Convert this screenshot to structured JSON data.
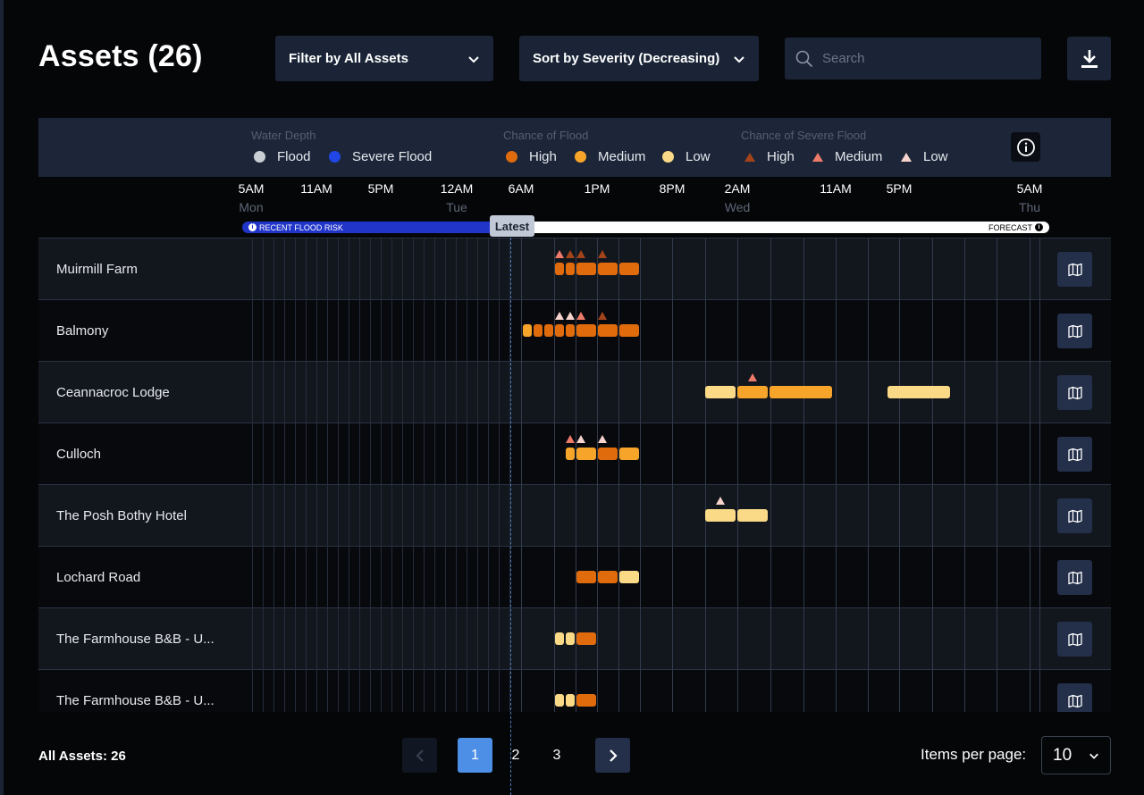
{
  "header": {
    "title": "Assets (26)",
    "filter_label": "Filter by All Assets",
    "sort_label": "Sort by Severity (Decreasing)",
    "search_placeholder": "Search"
  },
  "legend": {
    "water_depth": {
      "heading": "Water Depth",
      "items": [
        {
          "label": "Flood",
          "color": "#c9cdd4"
        },
        {
          "label": "Severe Flood",
          "color": "#2146e6"
        }
      ]
    },
    "chance_flood": {
      "heading": "Chance of Flood",
      "items": [
        {
          "label": "High",
          "color": "#e06b0c"
        },
        {
          "label": "Medium",
          "color": "#f7a52a"
        },
        {
          "label": "Low",
          "color": "#fad987"
        }
      ]
    },
    "chance_severe": {
      "heading": "Chance of Severe Flood",
      "items": [
        {
          "label": "High",
          "color": "#a3431a"
        },
        {
          "label": "Medium",
          "color": "#ee7a6a"
        },
        {
          "label": "Low",
          "color": "#f6d3cc"
        }
      ]
    }
  },
  "timeline": {
    "times": [
      "5AM",
      "11AM",
      "5PM",
      "12AM",
      "6AM",
      "1PM",
      "8PM",
      "2AM",
      "11AM",
      "5PM",
      "5AM"
    ],
    "days": [
      "Mon",
      "Tue",
      "Wed",
      "Thu"
    ],
    "recent_label": "RECENT FLOOD RISK",
    "forecast_label": "FORECAST",
    "latest_label": "Latest"
  },
  "assets": [
    {
      "name": "Muirmill Farm",
      "pills": [
        [
          "high",
          0,
          0
        ],
        [
          "high",
          1,
          1
        ],
        [
          "high",
          2,
          3
        ],
        [
          "high",
          4,
          5
        ],
        [
          "high",
          6,
          7
        ]
      ],
      "marks": [
        [
          "med",
          0
        ],
        [
          "high",
          1
        ],
        [
          "high",
          2
        ],
        [
          "high",
          4
        ]
      ]
    },
    {
      "name": "Balmony",
      "pills": [
        [
          "med",
          -3,
          -3
        ],
        [
          "high",
          -2,
          -2
        ],
        [
          "high",
          -1,
          -1
        ],
        [
          "high",
          0,
          0
        ],
        [
          "high",
          1,
          1
        ],
        [
          "high",
          2,
          3
        ],
        [
          "high",
          4,
          5
        ],
        [
          "high",
          6,
          7
        ]
      ],
      "marks": [
        [
          "low",
          0
        ],
        [
          "low",
          1
        ],
        [
          "med",
          2
        ],
        [
          "high",
          4
        ]
      ]
    },
    {
      "name": "Ceannacroc Lodge",
      "pills": [
        [
          "low",
          14,
          16
        ],
        [
          "med",
          17,
          19
        ],
        [
          "med",
          20,
          25
        ],
        [
          "low",
          31,
          36
        ]
      ],
      "marks": [
        [
          "med",
          18
        ]
      ]
    },
    {
      "name": "Culloch",
      "pills": [
        [
          "med",
          1,
          1
        ],
        [
          "med",
          2,
          3
        ],
        [
          "high",
          4,
          5
        ],
        [
          "med",
          6,
          7
        ]
      ],
      "marks": [
        [
          "med",
          1
        ],
        [
          "low",
          2
        ],
        [
          "low",
          4
        ]
      ]
    },
    {
      "name": "The Posh Bothy Hotel",
      "pills": [
        [
          "low",
          14,
          16
        ],
        [
          "low",
          17,
          19
        ]
      ],
      "marks": [
        [
          "low",
          15
        ]
      ]
    },
    {
      "name": "Lochard Road",
      "pills": [
        [
          "high",
          2,
          3
        ],
        [
          "high",
          4,
          5
        ],
        [
          "low",
          6,
          7
        ]
      ],
      "marks": []
    },
    {
      "name": "The Farmhouse B&B - U...",
      "pills": [
        [
          "low",
          0,
          0
        ],
        [
          "low",
          1,
          1
        ],
        [
          "high",
          2,
          3
        ]
      ],
      "marks": []
    },
    {
      "name": "The Farmhouse B&B - U...",
      "pills": [
        [
          "low",
          0,
          0
        ],
        [
          "low",
          1,
          1
        ],
        [
          "high",
          2,
          3
        ]
      ],
      "marks": []
    }
  ],
  "footer": {
    "total": "All Assets: 26",
    "pages": [
      "1",
      "2",
      "3"
    ],
    "items_per_page_label": "Items per page:",
    "items_per_page": "10"
  }
}
